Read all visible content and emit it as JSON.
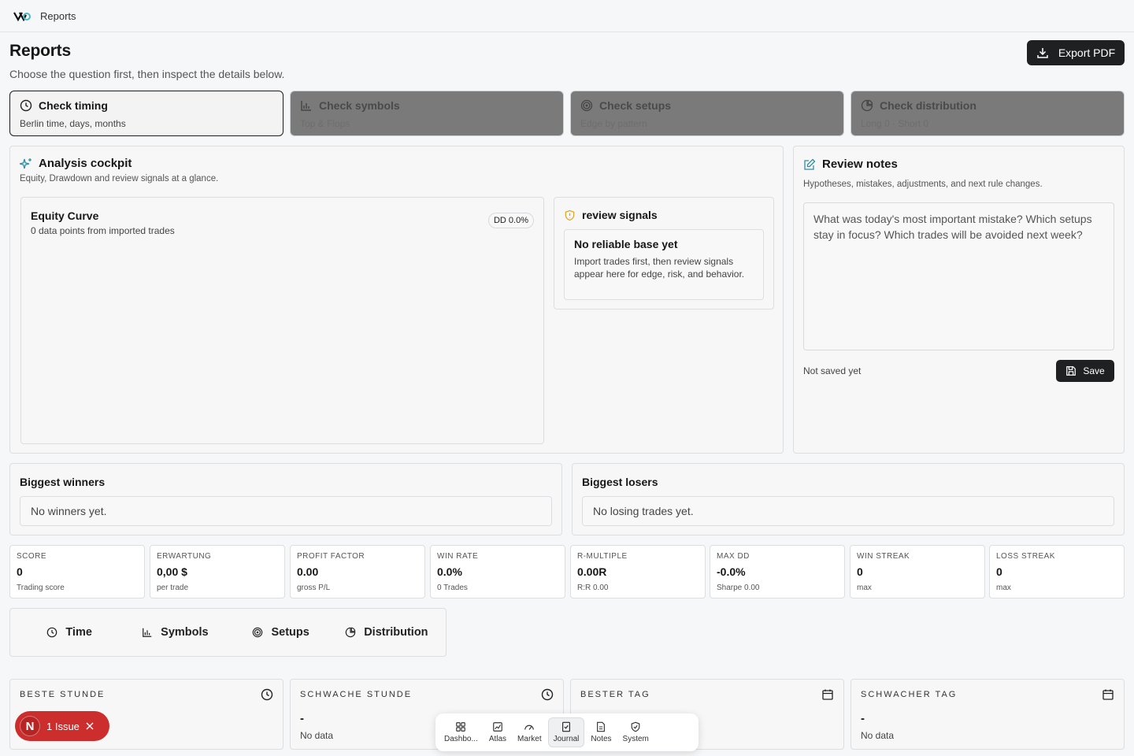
{
  "topbar": {
    "crumb": "Reports"
  },
  "header": {
    "title": "Reports",
    "subtitle": "Choose the question first, then inspect the details below.",
    "export_label": "Export PDF"
  },
  "questions": [
    {
      "title": "Check timing",
      "sub": "Berlin time, days, months",
      "icon": "clock-icon"
    },
    {
      "title": "Check symbols",
      "sub": "Top & Flops",
      "icon": "bar-chart-icon"
    },
    {
      "title": "Check setups",
      "sub": "Edge by pattern",
      "icon": "target-icon"
    },
    {
      "title": "Check distribution",
      "sub": "Long 0 · Short 0",
      "icon": "pie-chart-icon"
    }
  ],
  "cockpit": {
    "title": "Analysis cockpit",
    "subtitle": "Equity, Drawdown and review signals at a glance.",
    "equity": {
      "title": "Equity Curve",
      "subtitle": "0 data points from imported trades",
      "badge": "DD 0.0%"
    },
    "signals": {
      "title": "review signals",
      "empty_title": "No reliable base yet",
      "empty_text": "Import trades first, then review signals appear here for edge, risk, and behavior."
    }
  },
  "notes": {
    "title": "Review notes",
    "subtitle": "Hypotheses, mistakes, adjustments, and next rule changes.",
    "placeholder": "What was today's most important mistake? Which setups stay in focus? Which trades will be avoided next week?",
    "status": "Not saved yet",
    "save_label": "Save"
  },
  "winners": {
    "title": "Biggest winners",
    "empty": "No winners yet."
  },
  "losers": {
    "title": "Biggest losers",
    "empty": "No losing trades yet."
  },
  "stats": [
    {
      "label": "SCORE",
      "value": "0",
      "sub": "Trading score"
    },
    {
      "label": "ERWARTUNG",
      "value": "0,00 $",
      "sub": "per trade"
    },
    {
      "label": "PROFIT FACTOR",
      "value": "0.00",
      "sub": "gross P/L"
    },
    {
      "label": "WIN RATE",
      "value": "0.0%",
      "sub": "0 Trades"
    },
    {
      "label": "R-MULTIPLE",
      "value": "0.00R",
      "sub": "R:R 0.00"
    },
    {
      "label": "MAX DD",
      "value": "-0.0%",
      "sub": "Sharpe 0.00"
    },
    {
      "label": "WIN STREAK",
      "value": "0",
      "sub": "max"
    },
    {
      "label": "LOSS STREAK",
      "value": "0",
      "sub": "max"
    }
  ],
  "tabs": [
    {
      "label": "Time",
      "icon": "clock-icon"
    },
    {
      "label": "Symbols",
      "icon": "bar-chart-icon"
    },
    {
      "label": "Setups",
      "icon": "target-icon"
    },
    {
      "label": "Distribution",
      "icon": "pie-chart-icon"
    }
  ],
  "bottom_cards": [
    {
      "label": "BESTE STUNDE",
      "value": "",
      "sub": "",
      "icon": "clock-icon"
    },
    {
      "label": "SCHWACHE STUNDE",
      "value": "-",
      "sub": "No data",
      "icon": "clock-icon"
    },
    {
      "label": "BESTER TAG",
      "value": "",
      "sub": "",
      "icon": "calendar-icon"
    },
    {
      "label": "SCHWACHER TAG",
      "value": "-",
      "sub": "No data",
      "icon": "calendar-icon"
    }
  ],
  "dock": [
    {
      "label": "Dashbo...",
      "icon": "dashboard-icon"
    },
    {
      "label": "Atlas",
      "icon": "atlas-icon"
    },
    {
      "label": "Market",
      "icon": "gauge-icon"
    },
    {
      "label": "Journal",
      "icon": "journal-icon",
      "active": true
    },
    {
      "label": "Notes",
      "icon": "notes-icon"
    },
    {
      "label": "System",
      "icon": "shield-icon"
    }
  ],
  "issue": {
    "avatar": "N",
    "label": "1 Issue"
  }
}
